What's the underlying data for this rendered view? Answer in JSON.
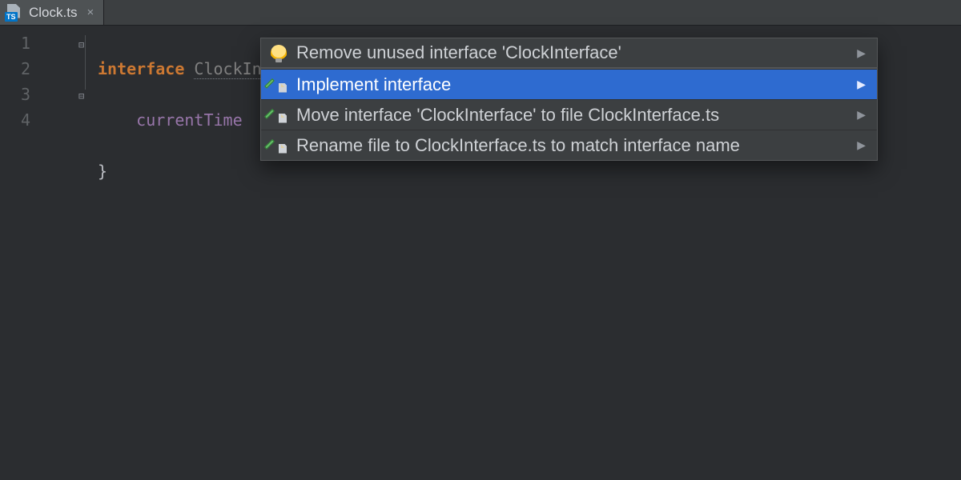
{
  "tab": {
    "filename": "Clock.ts",
    "icon_badge": "TS",
    "close_glyph": "×"
  },
  "gutter": {
    "lines": [
      "1",
      "2",
      "3",
      "4"
    ]
  },
  "fold": {
    "open_glyph": "⊟",
    "close_glyph": "⊟"
  },
  "code": {
    "l1": {
      "keyword": "interface",
      "name": "ClockInterface",
      "brace_open": " {"
    },
    "l2": {
      "prop": "currentTime"
    },
    "l3": {
      "brace_close": "}"
    }
  },
  "popup": {
    "arrow": "▶",
    "items": [
      {
        "icon": "bulb",
        "label": "Remove unused interface 'ClockInterface'"
      },
      {
        "icon": "pencil",
        "label": "Implement interface",
        "selected": true
      },
      {
        "icon": "pencil",
        "label": "Move interface 'ClockInterface' to file ClockInterface.ts"
      },
      {
        "icon": "pencil",
        "label": "Rename file to ClockInterface.ts to match interface name"
      }
    ]
  }
}
